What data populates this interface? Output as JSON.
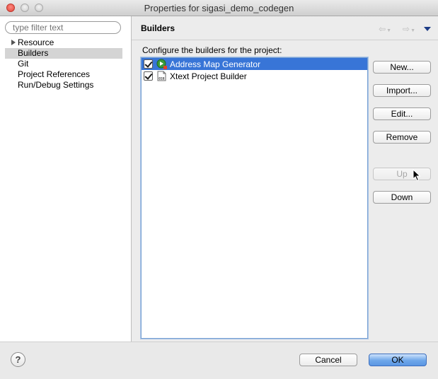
{
  "window": {
    "title": "Properties for sigasi_demo_codegen"
  },
  "filter": {
    "placeholder": "type filter text"
  },
  "tree": {
    "items": [
      {
        "label": "Resource",
        "expandable": true,
        "selected": false
      },
      {
        "label": "Builders",
        "expandable": false,
        "selected": true
      },
      {
        "label": "Git",
        "expandable": false,
        "selected": false
      },
      {
        "label": "Project References",
        "expandable": false,
        "selected": false
      },
      {
        "label": "Run/Debug Settings",
        "expandable": false,
        "selected": false
      }
    ]
  },
  "page": {
    "title": "Builders",
    "section_label": "Configure the builders for the project:"
  },
  "builders": [
    {
      "label": "Address Map Generator",
      "checked": true,
      "selected": true,
      "icon": "generator-icon"
    },
    {
      "label": "Xtext Project Builder",
      "checked": true,
      "selected": false,
      "icon": "binary-file-icon"
    }
  ],
  "buttons": {
    "new": "New...",
    "import": "Import...",
    "edit": "Edit...",
    "remove": "Remove",
    "up": "Up",
    "down": "Down"
  },
  "footer": {
    "help_icon": "question-mark-icon",
    "help_glyph": "?",
    "cancel": "Cancel",
    "ok": "OK"
  },
  "colors": {
    "selection": "#3875d7",
    "default_button": "#5b96e2"
  }
}
